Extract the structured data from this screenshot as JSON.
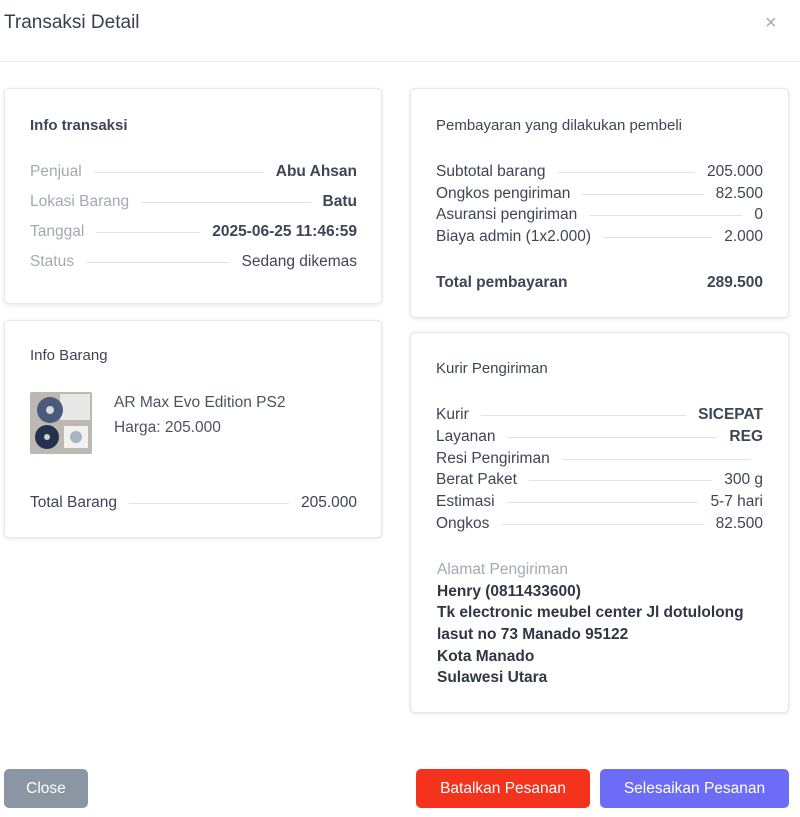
{
  "modal": {
    "title": "Transaksi Detail",
    "close_glyph": "×"
  },
  "info_transaksi": {
    "title": "Info transaksi",
    "rows": [
      {
        "label": "Penjual",
        "value": "Abu Ahsan"
      },
      {
        "label": "Lokasi Barang",
        "value": "Batu"
      },
      {
        "label": "Tanggal",
        "value": "2025-06-25 11:46:59"
      },
      {
        "label": "Status",
        "value": "Sedang dikemas"
      }
    ]
  },
  "info_barang": {
    "title": "Info Barang",
    "item_name": "AR Max Evo Edition PS2",
    "item_price": "Harga: 205.000",
    "total_label": "Total Barang",
    "total_value": "205.000"
  },
  "pembayaran": {
    "title": "Pembayaran yang dilakukan pembeli",
    "rows": [
      {
        "label": "Subtotal barang",
        "value": "205.000"
      },
      {
        "label": "Ongkos pengiriman",
        "value": "82.500"
      },
      {
        "label": "Asuransi pengiriman",
        "value": "0"
      },
      {
        "label": "Biaya admin (1x2.000)",
        "value": "2.000"
      }
    ],
    "total_label": "Total pembayaran",
    "total_value": "289.500"
  },
  "kurir": {
    "title": "Kurir Pengiriman",
    "rows": [
      {
        "label": "Kurir",
        "value": "SICEPAT"
      },
      {
        "label": "Layanan",
        "value": "REG"
      },
      {
        "label": "Resi Pengiriman",
        "value": ""
      },
      {
        "label": "Berat Paket",
        "value": "300 g"
      },
      {
        "label": "Estimasi",
        "value": "5-7 hari"
      },
      {
        "label": "Ongkos",
        "value": "82.500"
      }
    ],
    "address_label": "Alamat Pengiriman",
    "address_lines": [
      "Henry (0811433600)",
      "Tk electronic meubel center Jl dotulolong",
      "lasut no 73 Manado 95122",
      "Kota Manado",
      "Sulawesi Utara"
    ]
  },
  "buttons": {
    "close": "Close",
    "cancel": "Batalkan Pesanan",
    "finish": "Selesaikan Pesanan"
  },
  "colors": {
    "close_button": "#8a96a3",
    "cancel_button": "#f5321c",
    "finish_button": "#6c6cf6"
  },
  "icons": {
    "product_thumbnail": "product-photo"
  }
}
